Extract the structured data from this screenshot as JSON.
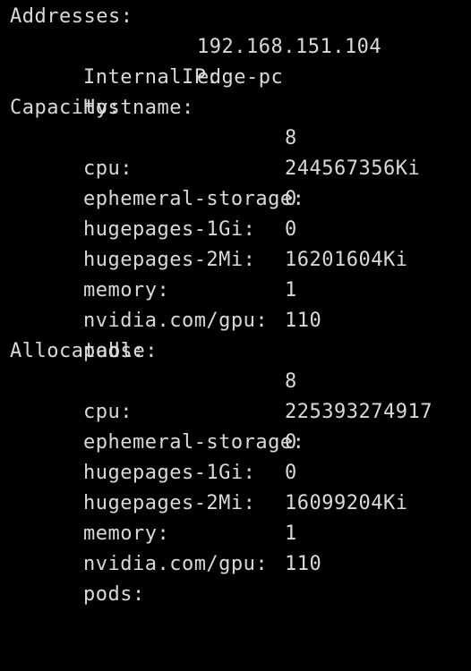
{
  "addresses": {
    "header": "Addresses:",
    "internal_ip_key": "InternalIP:",
    "internal_ip_value": "192.168.151.104",
    "hostname_key": "Hostname:",
    "hostname_value": "edge-pc"
  },
  "capacity": {
    "header": "Capacity:",
    "rows": [
      {
        "key": "cpu:",
        "value": "8"
      },
      {
        "key": "ephemeral-storage:",
        "value": "244567356Ki"
      },
      {
        "key": "hugepages-1Gi:",
        "value": "0"
      },
      {
        "key": "hugepages-2Mi:",
        "value": "0"
      },
      {
        "key": "memory:",
        "value": "16201604Ki"
      },
      {
        "key": "nvidia.com/gpu:",
        "value": "1"
      },
      {
        "key": "pods:",
        "value": "110"
      }
    ]
  },
  "allocatable": {
    "header": "Allocatable:",
    "rows": [
      {
        "key": "cpu:",
        "value": "8"
      },
      {
        "key": "ephemeral-storage:",
        "value": "225393274917"
      },
      {
        "key": "hugepages-1Gi:",
        "value": "0"
      },
      {
        "key": "hugepages-2Mi:",
        "value": "0"
      },
      {
        "key": "memory:",
        "value": "16099204Ki"
      },
      {
        "key": "nvidia.com/gpu:",
        "value": "1"
      },
      {
        "key": "pods:",
        "value": "110"
      }
    ]
  }
}
